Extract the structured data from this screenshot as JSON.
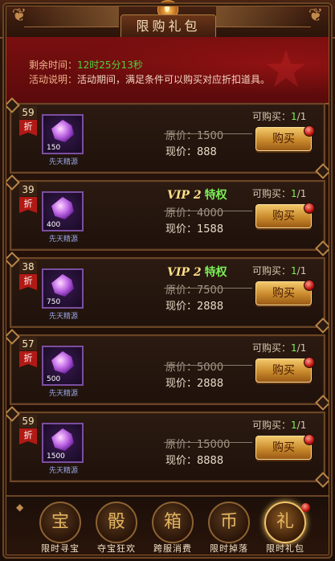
{
  "title": "限购礼包",
  "banner": {
    "remaining_label": "剩余时间：",
    "remaining_value": "12时25分13秒",
    "desc_label": "活动说明：",
    "desc_text": "活动期间，满足条件可以购买对应折扣道具。"
  },
  "cards": [
    {
      "discount": "59",
      "zhe": "折",
      "qty": "150",
      "name": "先天精源",
      "vip": null,
      "orig_label": "原价：",
      "orig": "1500",
      "now_label": "现价：",
      "now": "888",
      "limit_label": "可购买：",
      "limit_used": "1",
      "limit_total": "/1",
      "buy": "购买"
    },
    {
      "discount": "39",
      "zhe": "折",
      "qty": "400",
      "name": "先天精源",
      "vip": {
        "v": "VIP 2",
        "p": "特权"
      },
      "orig_label": "原价：",
      "orig": "4000",
      "now_label": "现价：",
      "now": "1588",
      "limit_label": "可购买：",
      "limit_used": "1",
      "limit_total": "/1",
      "buy": "购买"
    },
    {
      "discount": "38",
      "zhe": "折",
      "qty": "750",
      "name": "先天精源",
      "vip": {
        "v": "VIP 2",
        "p": "特权"
      },
      "orig_label": "原价：",
      "orig": "7500",
      "now_label": "现价：",
      "now": "2888",
      "limit_label": "可购买：",
      "limit_used": "1",
      "limit_total": "/1",
      "buy": "购买"
    },
    {
      "discount": "57",
      "zhe": "折",
      "qty": "500",
      "name": "先天精源",
      "vip": null,
      "orig_label": "原价：",
      "orig": "5000",
      "now_label": "现价：",
      "now": "2888",
      "limit_label": "可购买：",
      "limit_used": "1",
      "limit_total": "/1",
      "buy": "购买"
    },
    {
      "discount": "59",
      "zhe": "折",
      "qty": "1500",
      "name": "先天精源",
      "vip": null,
      "orig_label": "原价：",
      "orig": "15000",
      "now_label": "现价：",
      "now": "8888",
      "limit_label": "可购买：",
      "limit_used": "1",
      "limit_total": "/1",
      "buy": "购买"
    }
  ],
  "nav": [
    {
      "label": "限时寻宝",
      "icon": "treasure-icon",
      "glyph": "宝"
    },
    {
      "label": "夺宝狂欢",
      "icon": "dice-icon",
      "glyph": "骰"
    },
    {
      "label": "跨服消费",
      "icon": "chest-icon",
      "glyph": "箱"
    },
    {
      "label": "限时掉落",
      "icon": "coins-icon",
      "glyph": "币"
    },
    {
      "label": "限时礼包",
      "icon": "gift-icon",
      "glyph": "礼"
    }
  ],
  "colors": {
    "accent_green": "#7cf05a",
    "banner_red": "#7a0f10",
    "gold": "#f2c86a"
  }
}
